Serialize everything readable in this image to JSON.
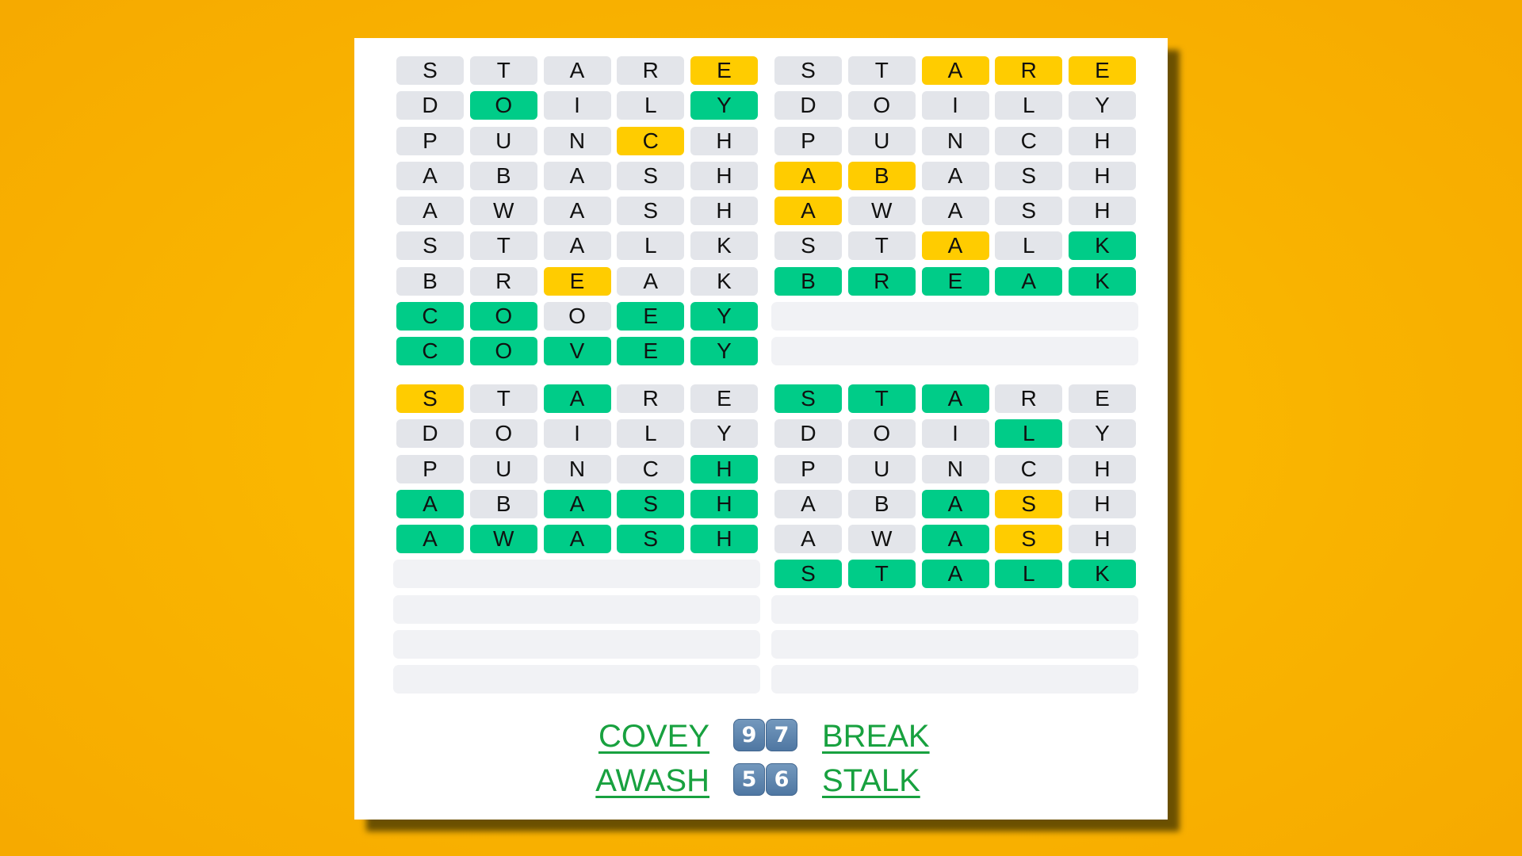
{
  "game": "Quordle",
  "colors": {
    "correct": "#00cc88",
    "present": "#ffcc00",
    "absent": "#e3e5ea",
    "empty": "#f1f2f5",
    "answer_link": "#18a13f",
    "background": "#f9b300"
  },
  "guesses": [
    "STARE",
    "DOILY",
    "PUNCH",
    "ABASH",
    "AWASH",
    "STALK",
    "BREAK",
    "COOEY",
    "COVEY"
  ],
  "boards": [
    {
      "name": "top-left",
      "answer": "COVEY",
      "solved_in": 9,
      "rows": [
        {
          "letters": [
            "S",
            "T",
            "A",
            "R",
            "E"
          ],
          "states": [
            "absent",
            "absent",
            "absent",
            "absent",
            "present"
          ]
        },
        {
          "letters": [
            "D",
            "O",
            "I",
            "L",
            "Y"
          ],
          "states": [
            "absent",
            "correct",
            "absent",
            "absent",
            "correct"
          ]
        },
        {
          "letters": [
            "P",
            "U",
            "N",
            "C",
            "H"
          ],
          "states": [
            "absent",
            "absent",
            "absent",
            "present",
            "absent"
          ]
        },
        {
          "letters": [
            "A",
            "B",
            "A",
            "S",
            "H"
          ],
          "states": [
            "absent",
            "absent",
            "absent",
            "absent",
            "absent"
          ]
        },
        {
          "letters": [
            "A",
            "W",
            "A",
            "S",
            "H"
          ],
          "states": [
            "absent",
            "absent",
            "absent",
            "absent",
            "absent"
          ]
        },
        {
          "letters": [
            "S",
            "T",
            "A",
            "L",
            "K"
          ],
          "states": [
            "absent",
            "absent",
            "absent",
            "absent",
            "absent"
          ]
        },
        {
          "letters": [
            "B",
            "R",
            "E",
            "A",
            "K"
          ],
          "states": [
            "absent",
            "absent",
            "present",
            "absent",
            "absent"
          ]
        },
        {
          "letters": [
            "C",
            "O",
            "O",
            "E",
            "Y"
          ],
          "states": [
            "correct",
            "correct",
            "absent",
            "correct",
            "correct"
          ]
        },
        {
          "letters": [
            "C",
            "O",
            "V",
            "E",
            "Y"
          ],
          "states": [
            "correct",
            "correct",
            "correct",
            "correct",
            "correct"
          ]
        }
      ],
      "empty_rows": 0
    },
    {
      "name": "top-right",
      "answer": "BREAK",
      "solved_in": 7,
      "rows": [
        {
          "letters": [
            "S",
            "T",
            "A",
            "R",
            "E"
          ],
          "states": [
            "absent",
            "absent",
            "present",
            "present",
            "present"
          ]
        },
        {
          "letters": [
            "D",
            "O",
            "I",
            "L",
            "Y"
          ],
          "states": [
            "absent",
            "absent",
            "absent",
            "absent",
            "absent"
          ]
        },
        {
          "letters": [
            "P",
            "U",
            "N",
            "C",
            "H"
          ],
          "states": [
            "absent",
            "absent",
            "absent",
            "absent",
            "absent"
          ]
        },
        {
          "letters": [
            "A",
            "B",
            "A",
            "S",
            "H"
          ],
          "states": [
            "present",
            "present",
            "absent",
            "absent",
            "absent"
          ]
        },
        {
          "letters": [
            "A",
            "W",
            "A",
            "S",
            "H"
          ],
          "states": [
            "present",
            "absent",
            "absent",
            "absent",
            "absent"
          ]
        },
        {
          "letters": [
            "S",
            "T",
            "A",
            "L",
            "K"
          ],
          "states": [
            "absent",
            "absent",
            "present",
            "absent",
            "correct"
          ]
        },
        {
          "letters": [
            "B",
            "R",
            "E",
            "A",
            "K"
          ],
          "states": [
            "correct",
            "correct",
            "correct",
            "correct",
            "correct"
          ]
        }
      ],
      "empty_rows": 2
    },
    {
      "name": "bottom-left",
      "answer": "AWASH",
      "solved_in": 5,
      "rows": [
        {
          "letters": [
            "S",
            "T",
            "A",
            "R",
            "E"
          ],
          "states": [
            "present",
            "absent",
            "correct",
            "absent",
            "absent"
          ]
        },
        {
          "letters": [
            "D",
            "O",
            "I",
            "L",
            "Y"
          ],
          "states": [
            "absent",
            "absent",
            "absent",
            "absent",
            "absent"
          ]
        },
        {
          "letters": [
            "P",
            "U",
            "N",
            "C",
            "H"
          ],
          "states": [
            "absent",
            "absent",
            "absent",
            "absent",
            "correct"
          ]
        },
        {
          "letters": [
            "A",
            "B",
            "A",
            "S",
            "H"
          ],
          "states": [
            "correct",
            "absent",
            "correct",
            "correct",
            "correct"
          ]
        },
        {
          "letters": [
            "A",
            "W",
            "A",
            "S",
            "H"
          ],
          "states": [
            "correct",
            "correct",
            "correct",
            "correct",
            "correct"
          ]
        }
      ],
      "empty_rows": 4
    },
    {
      "name": "bottom-right",
      "answer": "STALK",
      "solved_in": 6,
      "rows": [
        {
          "letters": [
            "S",
            "T",
            "A",
            "R",
            "E"
          ],
          "states": [
            "correct",
            "correct",
            "correct",
            "absent",
            "absent"
          ]
        },
        {
          "letters": [
            "D",
            "O",
            "I",
            "L",
            "Y"
          ],
          "states": [
            "absent",
            "absent",
            "absent",
            "correct",
            "absent"
          ]
        },
        {
          "letters": [
            "P",
            "U",
            "N",
            "C",
            "H"
          ],
          "states": [
            "absent",
            "absent",
            "absent",
            "absent",
            "absent"
          ]
        },
        {
          "letters": [
            "A",
            "B",
            "A",
            "S",
            "H"
          ],
          "states": [
            "absent",
            "absent",
            "correct",
            "present",
            "absent"
          ]
        },
        {
          "letters": [
            "A",
            "W",
            "A",
            "S",
            "H"
          ],
          "states": [
            "absent",
            "absent",
            "correct",
            "present",
            "absent"
          ]
        },
        {
          "letters": [
            "S",
            "T",
            "A",
            "L",
            "K"
          ],
          "states": [
            "correct",
            "correct",
            "correct",
            "correct",
            "correct"
          ]
        }
      ],
      "empty_rows": 3
    }
  ],
  "results": [
    {
      "left_word": "COVEY",
      "left_score": "9",
      "right_score": "7",
      "right_word": "BREAK"
    },
    {
      "left_word": "AWASH",
      "left_score": "5",
      "right_score": "6",
      "right_word": "STALK"
    }
  ]
}
